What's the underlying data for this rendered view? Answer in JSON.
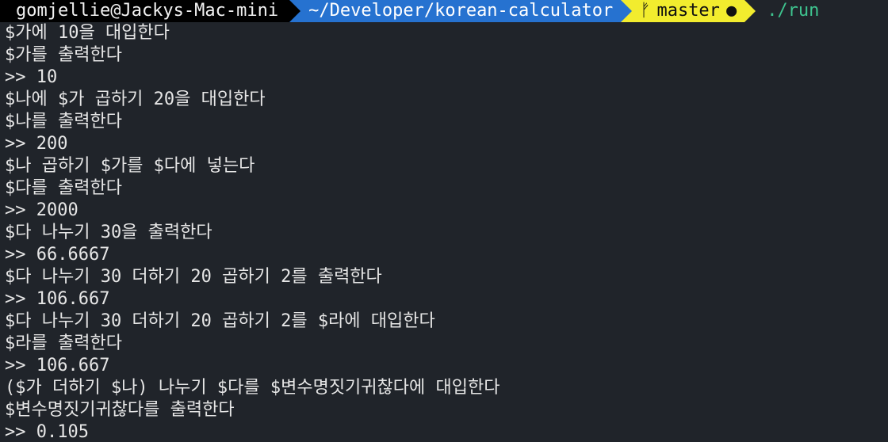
{
  "prompt": {
    "user_host": "gomjellie@Jackys-Mac-mini",
    "path": "~/Developer/korean-calculator",
    "branch": "master",
    "branch_icon": "ᚠ",
    "dirty_icon": "●",
    "command": "./run"
  },
  "output_lines": [
    "$가에 10을 대입한다",
    "$가를 출력한다",
    ">> 10",
    "$나에 $가 곱하기 20을 대입한다",
    "$나를 출력한다",
    ">> 200",
    "$나 곱하기 $가를 $다에 넣는다",
    "$다를 출력한다",
    ">> 2000",
    "$다 나누기 30을 출력한다",
    ">> 66.6667",
    "$다 나누기 30 더하기 20 곱하기 2를 출력한다",
    ">> 106.667",
    "$다 나누기 30 더하기 20 곱하기 2를 $라에 대입한다",
    "$라를 출력한다",
    ">> 106.667",
    "($가 더하기 $나) 나누기 $다를 $변수명짓기귀찮다에 대입한다",
    "$변수명짓기귀찮다를 출력한다",
    ">> 0.105"
  ]
}
